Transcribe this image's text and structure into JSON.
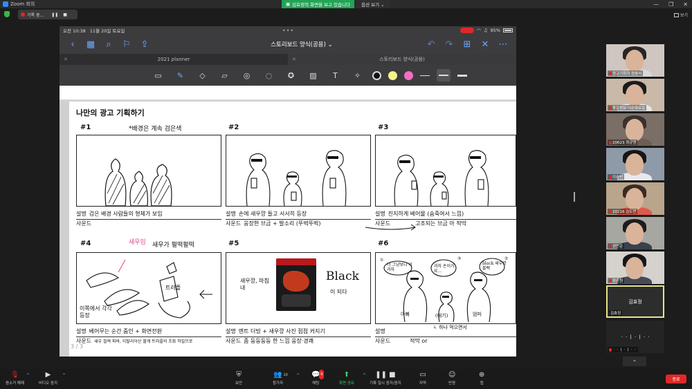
{
  "window": {
    "title": "Zoom 회의",
    "controls": [
      "—",
      "❐",
      "✕"
    ]
  },
  "recording": {
    "label": "기록 중...",
    "pause": "❚❚",
    "stop": "■"
  },
  "share_banner": {
    "text": "김효정의 화면을 보고 있습니다",
    "options": "옵션 보기 ⌄"
  },
  "gallery_label": "보기",
  "ipad": {
    "time": "오전 10:38",
    "date": "11월 20일 토요일",
    "dots": "•••",
    "battery": "95%",
    "doc_title": "스토리보드 양식(공용) ⌄",
    "tabs": [
      {
        "label": "2021 planner",
        "close": "✕"
      },
      {
        "label": "스토리보드 양식(공용)",
        "close": "✕"
      }
    ]
  },
  "page": {
    "title": "나만의 광고 기획하기",
    "page_num": "3 / 3",
    "desc_label": "설명",
    "sound_label": "사운드",
    "scenes": [
      {
        "num": "#1",
        "note": "*배경은 계속 검은색",
        "desc": "검은 배경 사람들의 형체가 보임",
        "sound": ""
      },
      {
        "num": "#2",
        "note": "",
        "desc": "손에 새우깡 들고 서서히 등장",
        "sound": "웅장한 브금 + 발소리 (뚜벅뚜벅)"
      },
      {
        "num": "#3",
        "note": "",
        "desc": "진지하게 베어물 (숨죽여서 느낌)",
        "sound": "고조되는 브금 아 적막"
      },
      {
        "num": "#4",
        "note": "새우가 펄떡펄떡",
        "desc": "베어무는 순간 줌인 + 화면전환",
        "sound": "새우 철썩 파바, 이탈리아산 볼캐 트러플의 조화 하빌므로"
      },
      {
        "num": "#5",
        "note": "",
        "desc": "멘트 더빙 + 새우깡 사진 점점 커지기",
        "sound": "좀 둥둥둥둥 한 느낌 웅장·경쾌"
      },
      {
        "num": "#6",
        "note": "",
        "desc": "",
        "sound": "적막 or"
      }
    ],
    "frame_texts": {
      "pink": "새우임",
      "anchovy": "이쪽에서 각각 등장",
      "truffle": "트러플",
      "f5_left": "새우깡, 마침내",
      "f5_black": "Black",
      "f5_right": "이 되다",
      "b1": "너 그냥보니 이 과자",
      "b2": "과자 손이가요...",
      "b3": "black 새우깡블랙",
      "n1": "①",
      "n2": "②",
      "n3": "③",
      "p1": "아빠",
      "p2": "(애기)",
      "p3": "엄마",
      "arrow_note": "↳ 하나 먹으면서"
    }
  },
  "participants": [
    {
      "name": "광고기획자 정윤서",
      "hair": "#2a2424",
      "bg": "#cfc6c2",
      "shirt": "#d8d8d8"
    },
    {
      "name": "좋은정보 나은화요일",
      "hair": "#1b1b1b",
      "bg": "#c9b9a8",
      "shirt": "#e6e6e6"
    },
    {
      "name": "20623 최규영",
      "hair": "#3b3030",
      "bg": "#7a6e66",
      "shirt": "#6d5f55"
    },
    {
      "name": "이승빈",
      "hair": "#161616",
      "bg": "#8f9aa8",
      "shirt": "#e8e8ee"
    },
    {
      "name": "20216 김도연",
      "hair": "#3a2a22",
      "bg": "#b9a48c",
      "shirt": "#dd5a4c"
    },
    {
      "name": "권민준",
      "hair": "#1d1d1d",
      "bg": "#a7a7a2",
      "shirt": "#39404e"
    },
    {
      "name": "장준원",
      "hair": "#161616",
      "bg": "#d5d2ce",
      "shirt": "#454a55"
    },
    {
      "name": "김효정",
      "type": "active"
    },
    {
      "name": "ㆍㆍㅣㆍㅣㆍㆍ",
      "type": "dark"
    }
  ],
  "toolbar": {
    "mic": "음소거 해제",
    "video": "비디오 중지",
    "security": "보안",
    "participants": "참가자",
    "participants_count": "10",
    "chat": "채팅",
    "chat_badge": "9",
    "share": "화면 공유",
    "record": "기록 일시 중지/중지",
    "captions": "자막",
    "reactions": "반응",
    "apps": "앱",
    "end": "종료"
  }
}
